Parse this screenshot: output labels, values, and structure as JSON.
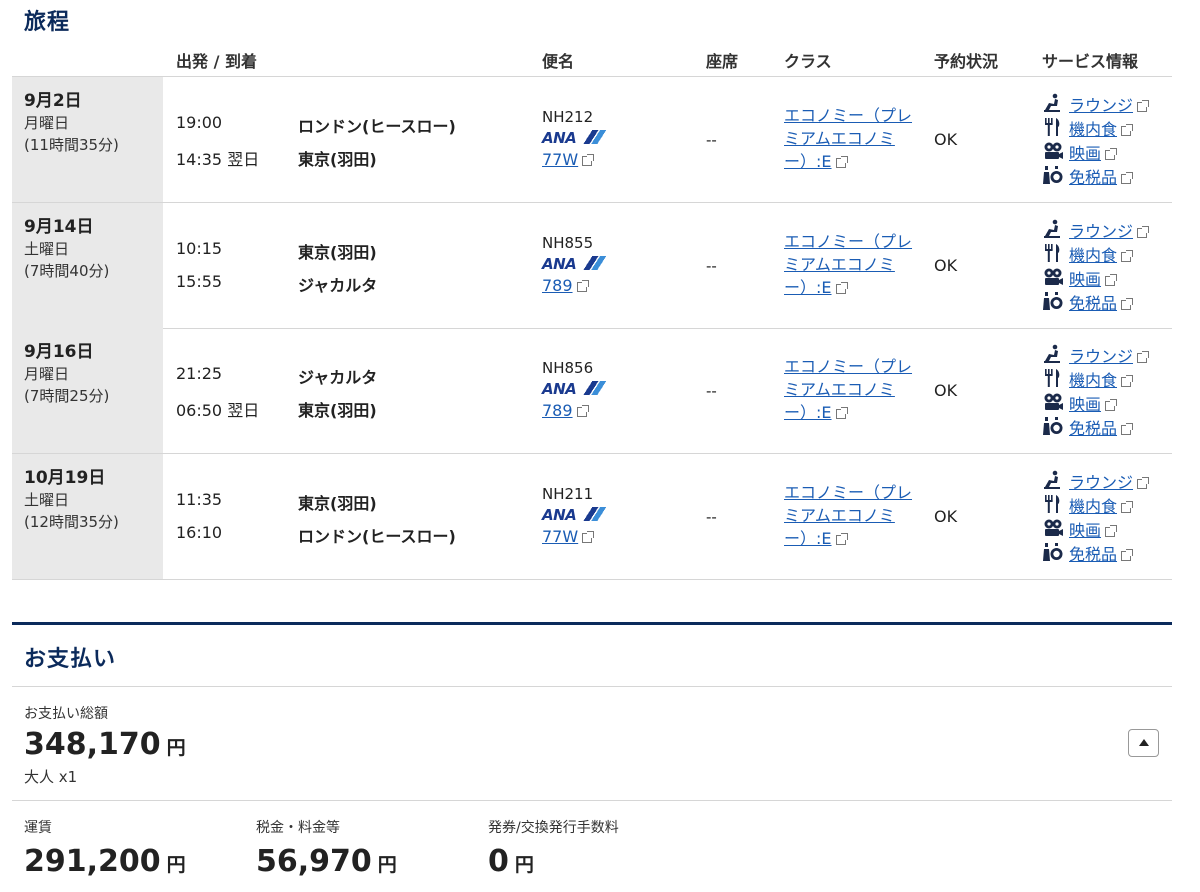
{
  "itinerary": {
    "title": "旅程",
    "headers": {
      "departure_arrival": "出発 / 到着",
      "flight": "便名",
      "seat": "座席",
      "class": "クラス",
      "status": "予約状況",
      "service": "サービス情報"
    },
    "rows": [
      {
        "date": "9月2日",
        "weekday": "月曜日",
        "duration": "(11時間35分)",
        "dep_time": "19:00",
        "dep_city": "ロンドン(ヒースロー)",
        "arr_time": "14:35 翌日",
        "arr_city": "東京(羽田)",
        "flight_no": "NH212",
        "airline": "ANA",
        "equipment": "77W",
        "seat": "--",
        "class_line1": "エコノミー（プレ",
        "class_line2": "ミアムエコノミ",
        "class_line3": "ー）:E",
        "status": "OK"
      },
      {
        "date": "9月14日",
        "weekday": "土曜日",
        "duration": "(7時間40分)",
        "dep_time": "10:15",
        "dep_city": "東京(羽田)",
        "arr_time": "15:55",
        "arr_city": "ジャカルタ",
        "flight_no": "NH855",
        "airline": "ANA",
        "equipment": "789",
        "seat": "--",
        "class_line1": "エコノミー（プレ",
        "class_line2": "ミアムエコノミ",
        "class_line3": "ー）:E",
        "status": "OK"
      },
      {
        "date": "9月16日",
        "weekday": "月曜日",
        "duration": "(7時間25分)",
        "dep_time": "21:25",
        "dep_city": "ジャカルタ",
        "arr_time": "06:50 翌日",
        "arr_city": "東京(羽田)",
        "flight_no": "NH856",
        "airline": "ANA",
        "equipment": "789",
        "seat": "--",
        "class_line1": "エコノミー（プレ",
        "class_line2": "ミアムエコノミ",
        "class_line3": "ー）:E",
        "status": "OK"
      },
      {
        "date": "10月19日",
        "weekday": "土曜日",
        "duration": "(12時間35分)",
        "dep_time": "11:35",
        "dep_city": "東京(羽田)",
        "arr_time": "16:10",
        "arr_city": "ロンドン(ヒースロー)",
        "flight_no": "NH211",
        "airline": "ANA",
        "equipment": "77W",
        "seat": "--",
        "class_line1": "エコノミー（プレ",
        "class_line2": "ミアムエコノミ",
        "class_line3": "ー）:E",
        "status": "OK"
      }
    ],
    "services": [
      {
        "label": "ラウンジ",
        "icon": "lounge-icon"
      },
      {
        "label": "機内食",
        "icon": "meal-icon"
      },
      {
        "label": "映画",
        "icon": "movie-icon"
      },
      {
        "label": "免税品",
        "icon": "duty-free-icon"
      }
    ]
  },
  "payment": {
    "title": "お支払い",
    "total_label": "お支払い総額",
    "total_amount": "348,170",
    "currency": "円",
    "passengers": "大人 x1",
    "fare_label": "運賃",
    "fare_amount": "291,200",
    "tax_label": "税金・料金等",
    "tax_amount": "56,970",
    "fee_label": "発券/交換発行手数料",
    "fee_amount": "0"
  },
  "colors": {
    "heading": "#0b2a5b",
    "link": "#1a5cb4",
    "date_cell_bg": "#e9e9e9",
    "ana_blue": "#1a3a8f"
  }
}
